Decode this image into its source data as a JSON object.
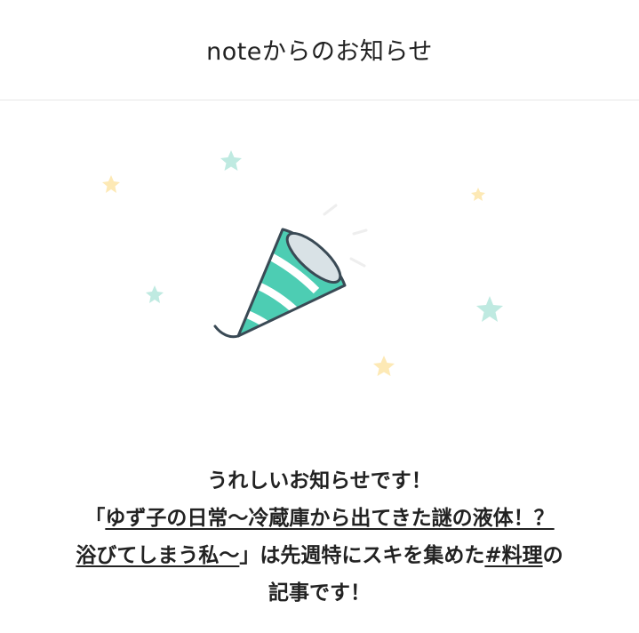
{
  "header": {
    "title": "noteからのお知らせ"
  },
  "illustration": {
    "icon": "party-popper",
    "colors": {
      "cone_green": "#4dcdb3",
      "cone_white": "#ffffff",
      "outline": "#3a4a55",
      "star_mint": "#bfeae1",
      "star_yellow": "#fde9b5"
    }
  },
  "message": {
    "line1": "うれしいお知らせです！",
    "article_open_quote": "「",
    "article_title_part1": "ゆず子の日常〜冷蔵庫から出てきた謎の液体！？",
    "article_title_part2": "浴びてしまう私〜",
    "article_close_quote": "」",
    "middle_text": "は先週特にスキを集めた",
    "hashtag": "#料理",
    "after_hashtag": "の",
    "line_end": "記事です！"
  }
}
